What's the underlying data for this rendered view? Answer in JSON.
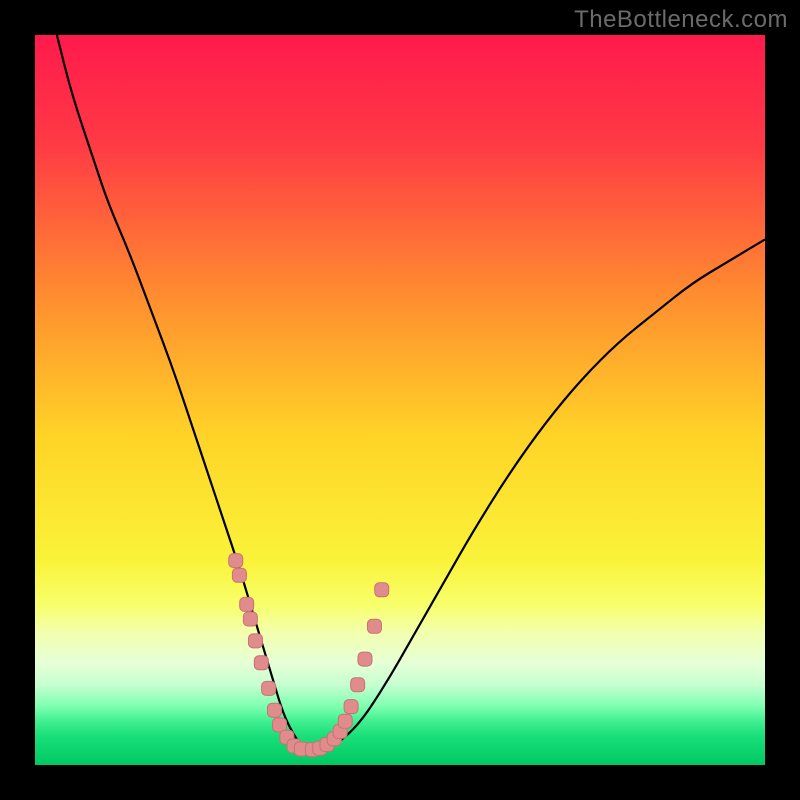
{
  "watermark": "TheBottleneck.com",
  "colors": {
    "frame": "#000000",
    "gradient_stops": [
      {
        "offset": 0.0,
        "color": "#ff1a4c"
      },
      {
        "offset": 0.15,
        "color": "#ff3a45"
      },
      {
        "offset": 0.35,
        "color": "#ff8a30"
      },
      {
        "offset": 0.55,
        "color": "#ffd427"
      },
      {
        "offset": 0.72,
        "color": "#faf33a"
      },
      {
        "offset": 0.78,
        "color": "#f8ff6a"
      },
      {
        "offset": 0.82,
        "color": "#f2ffb0"
      },
      {
        "offset": 0.86,
        "color": "#e6ffd6"
      },
      {
        "offset": 0.89,
        "color": "#c6ffd0"
      },
      {
        "offset": 0.92,
        "color": "#7dffb0"
      },
      {
        "offset": 0.94,
        "color": "#40f090"
      },
      {
        "offset": 0.96,
        "color": "#1adf7a"
      },
      {
        "offset": 1.0,
        "color": "#00c862"
      }
    ],
    "curve": "#000000",
    "marker_fill": "#e08c8c",
    "marker_stroke": "#c87272"
  },
  "chart_data": {
    "type": "line",
    "title": "",
    "xlabel": "",
    "ylabel": "",
    "xlim": [
      0,
      100
    ],
    "ylim": [
      0,
      100
    ],
    "grid": false,
    "legend": false,
    "series": [
      {
        "name": "bottleneck-curve",
        "x": [
          3,
          5,
          8,
          10,
          13,
          16,
          19,
          22,
          24,
          26,
          28,
          29.5,
          31,
          32.5,
          34,
          35.5,
          37,
          40,
          44,
          48,
          52,
          56,
          60,
          65,
          70,
          75,
          80,
          85,
          90,
          95,
          100
        ],
        "y": [
          100,
          92,
          83,
          77,
          70,
          62,
          54,
          45,
          39,
          33,
          27,
          22,
          17,
          12,
          7,
          4,
          2,
          2,
          5,
          11,
          18,
          25,
          32,
          40,
          47,
          53,
          58,
          62,
          66,
          69,
          72
        ]
      }
    ],
    "markers": {
      "name": "sample-points",
      "x": [
        27.5,
        28,
        29,
        29.5,
        30.2,
        31,
        32,
        32.8,
        33.5,
        34.5,
        35.5,
        36.5,
        38,
        39,
        40,
        41,
        41.8,
        42.5,
        43.3,
        44.2,
        45.2,
        46.5,
        47.5
      ],
      "y": [
        28,
        26,
        22,
        20,
        17,
        14,
        10.5,
        7.5,
        5.5,
        3.8,
        2.6,
        2.2,
        2.1,
        2.3,
        2.8,
        3.6,
        4.6,
        6,
        8,
        11,
        14.5,
        19,
        24
      ]
    }
  }
}
